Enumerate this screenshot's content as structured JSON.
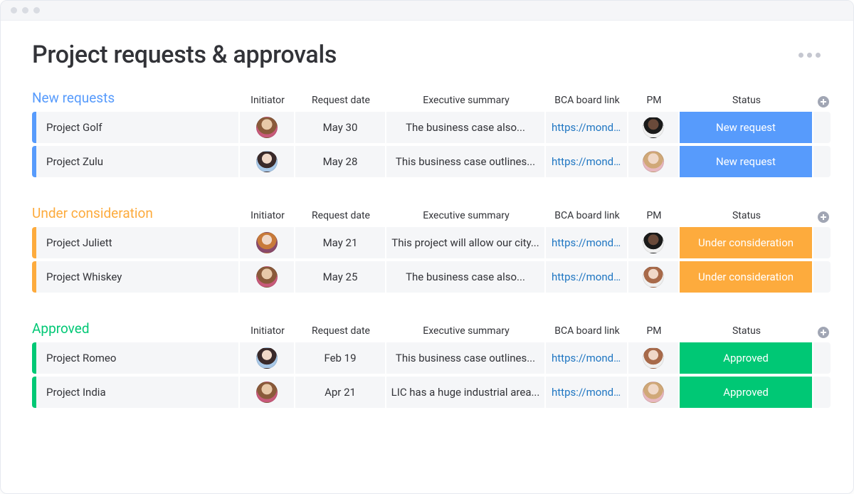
{
  "page": {
    "title": "Project requests & approvals"
  },
  "columns": {
    "initiator": "Initiator",
    "request_date": "Request date",
    "exec_summary": "Executive summary",
    "bca_link": "BCA board link",
    "pm": "PM",
    "status": "Status"
  },
  "groups": [
    {
      "name": "New requests",
      "color": "#579bfc",
      "rows": [
        {
          "name": "Project Golf",
          "initiator_avatar": "av1",
          "date": "May 30",
          "summary": "The business case also...",
          "link": "https://mond...",
          "pm_avatar": "av3",
          "status_label": "New request",
          "status_color": "#579bfc"
        },
        {
          "name": "Project Zulu",
          "initiator_avatar": "av2",
          "date": "May 28",
          "summary": "This business case outlines...",
          "link": "https://mond...",
          "pm_avatar": "av4",
          "status_label": "New request",
          "status_color": "#579bfc"
        }
      ]
    },
    {
      "name": "Under consideration",
      "color": "#fdab3d",
      "rows": [
        {
          "name": "Project Juliett",
          "initiator_avatar": "av5",
          "date": "May 21",
          "summary": "This project will allow our city...",
          "link": "https://mond...",
          "pm_avatar": "av3",
          "status_label": "Under consideration",
          "status_color": "#fdab3d"
        },
        {
          "name": "Project Whiskey",
          "initiator_avatar": "av1",
          "date": "May 25",
          "summary": "The business case also...",
          "link": "https://mond...",
          "pm_avatar": "av6",
          "status_label": "Under consideration",
          "status_color": "#fdab3d"
        }
      ]
    },
    {
      "name": "Approved",
      "color": "#00c875",
      "rows": [
        {
          "name": "Project Romeo",
          "initiator_avatar": "av2",
          "date": "Feb 19",
          "summary": "This business case outlines...",
          "link": "https://mond...",
          "pm_avatar": "av6",
          "status_label": "Approved",
          "status_color": "#00c875"
        },
        {
          "name": "Project India",
          "initiator_avatar": "av1",
          "date": "Apr 21",
          "summary": "LIC has a huge industrial area...",
          "link": "https://mond...",
          "pm_avatar": "av4",
          "status_label": "Approved",
          "status_color": "#00c875"
        }
      ]
    }
  ]
}
